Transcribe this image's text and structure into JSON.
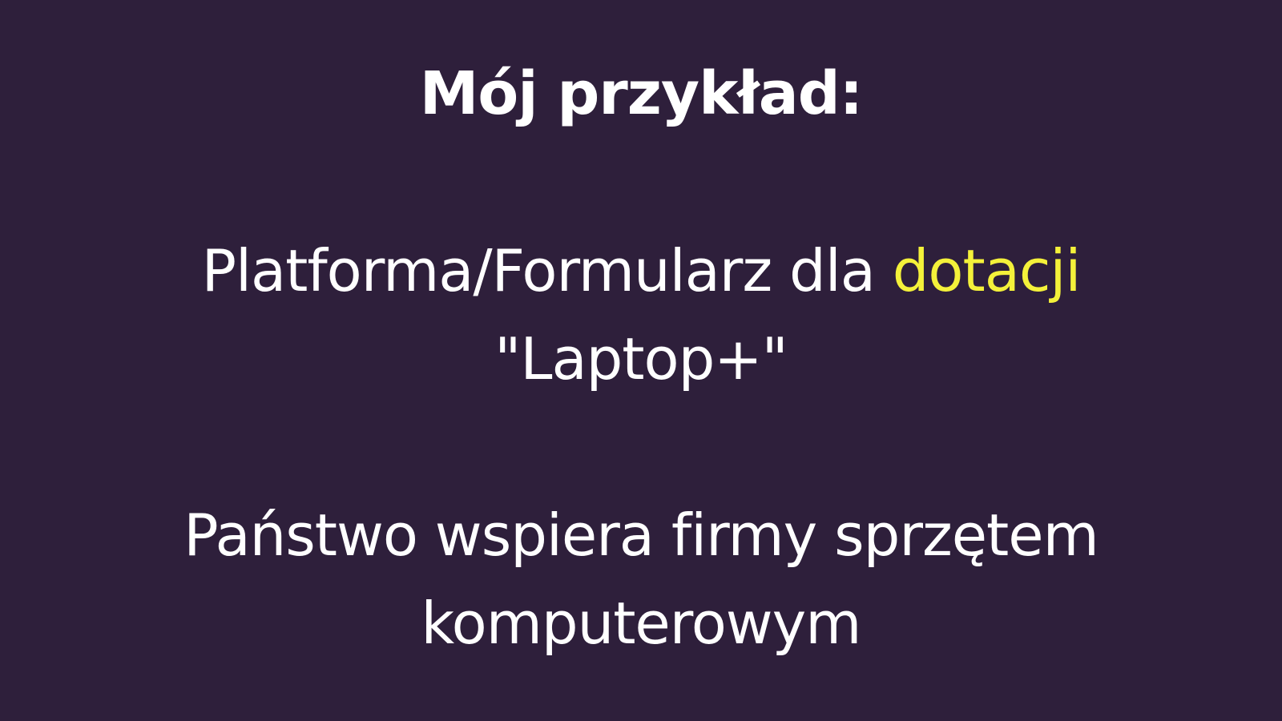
{
  "colors": {
    "background": "#2e1f3b",
    "text": "#ffffff",
    "highlight": "#f4f13a"
  },
  "slide": {
    "title": "Mój przykład:",
    "paragraph1": {
      "line1_prefix": "Platforma/Formularz dla ",
      "line1_highlight": "dotacji",
      "line2": "\"Laptop+\""
    },
    "paragraph2": {
      "line1": "Państwo wspiera firmy sprzętem",
      "line2": "komputerowym"
    }
  }
}
